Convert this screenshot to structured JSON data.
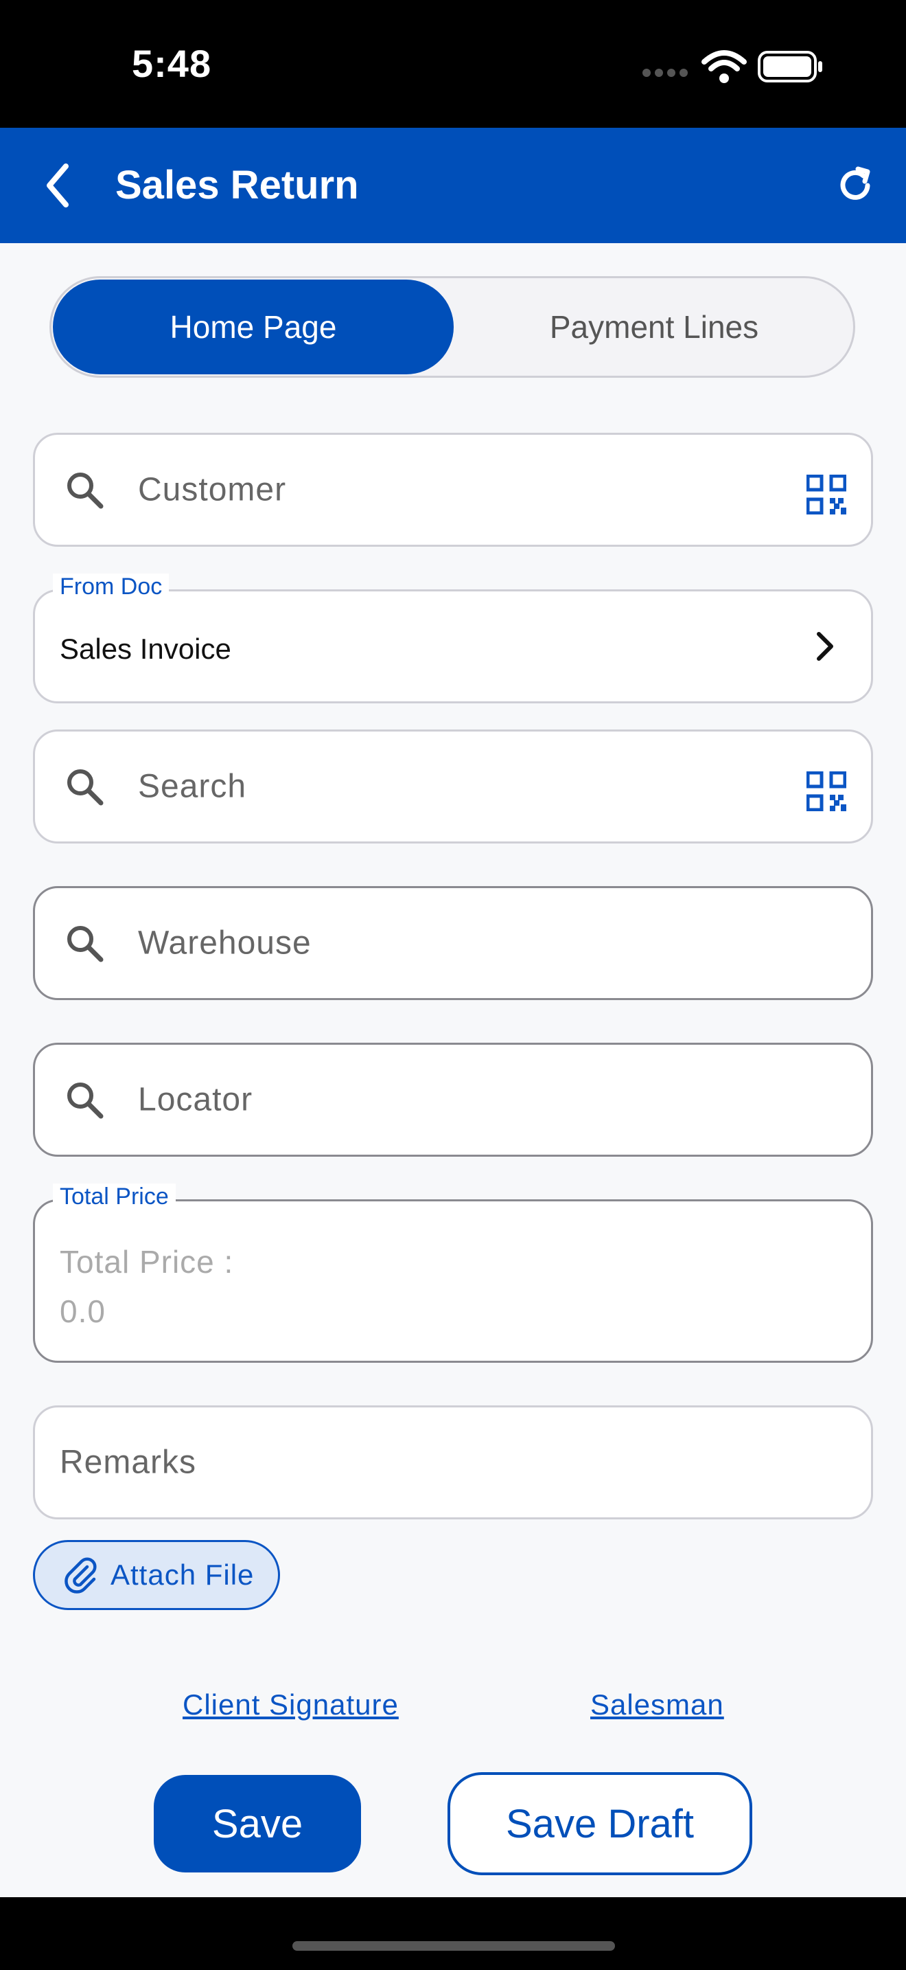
{
  "status_bar": {
    "time": "5:48"
  },
  "header": {
    "title": "Sales Return"
  },
  "segments": [
    {
      "label": "Home Page"
    },
    {
      "label": "Payment Lines"
    }
  ],
  "fields": {
    "customer": {
      "placeholder": "Customer"
    },
    "from_doc": {
      "legend": "From Doc",
      "value": "Sales Invoice"
    },
    "search": {
      "placeholder": "Search"
    },
    "warehouse": {
      "placeholder": "Warehouse"
    },
    "locator": {
      "placeholder": "Locator"
    },
    "total_price": {
      "legend": "Total Price",
      "label": "Total Price :",
      "value": "0.0"
    },
    "remarks": {
      "placeholder": "Remarks"
    }
  },
  "attach": {
    "label": "Attach File"
  },
  "links": {
    "client_signature": "Client Signature",
    "salesman": "Salesman"
  },
  "actions": {
    "save": "Save",
    "save_draft": "Save Draft"
  },
  "colors": {
    "primary": "#004fb9",
    "accent": "#0b55c4"
  }
}
